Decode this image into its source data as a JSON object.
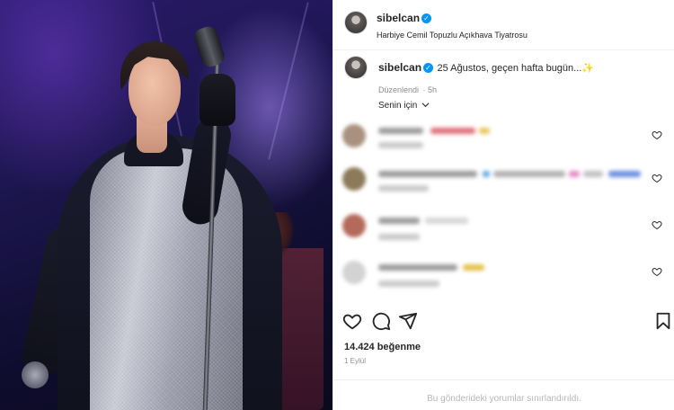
{
  "post": {
    "author": {
      "username": "sibelcan",
      "verified": true,
      "location": "Harbiye Cemil Topuzlu Açıkhava Tiyatrosu"
    },
    "caption": {
      "username": "sibelcan",
      "text": "25 Ağustos, geçen hafta bugün...✨",
      "edited_label": "Düzenlendi",
      "time": "5h"
    },
    "comments_sort_label": "Senin için",
    "likes_text": "14.424 beğenme",
    "date_text": "1 Eylül",
    "comments_restricted_text": "Bu gönderideki yorumlar sınırlandırıldı."
  },
  "icons": {
    "like": "heart-icon",
    "comment": "comment-icon",
    "share": "send-icon",
    "save": "bookmark-icon"
  },
  "colors": {
    "verified_badge": "#0095f6",
    "text_primary": "#262626",
    "text_secondary": "#8e8e8e",
    "photo_background": "#1d1650"
  }
}
